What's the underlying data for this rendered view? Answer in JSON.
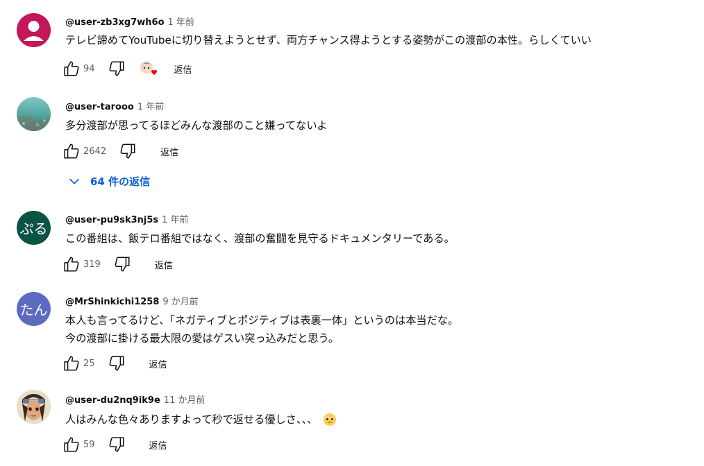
{
  "reply_label": "返信",
  "comments": [
    {
      "user": "@user-zb3xg7wh6o",
      "time": "1 年前",
      "text": [
        "テレビ諦めてYouTubeに切り替えようとせず、両方チャンス得ようとする姿勢がこの渡部の本性。らしくていい"
      ],
      "likes": "94",
      "avatar_color": "#c2185b",
      "hearted": true
    },
    {
      "user": "@user-tarooo",
      "time": "1 年前",
      "text": [
        "多分渡部が思ってるほどみんな渡部のこと嫌ってないよ"
      ],
      "likes": "2642",
      "avatar_color": "#5aa6a0",
      "replies": "64 件の返信"
    },
    {
      "user": "@user-pu9sk3nj5s",
      "time": "1 年前",
      "text": [
        "この番組は、飯テロ番組ではなく、渡部の奮闘を見守るドキュメンタリーである。"
      ],
      "likes": "319",
      "avatar_color": "#0b5345",
      "avatar_text": "ぷる"
    },
    {
      "user": "@MrShinkichi1258",
      "time": "9 か月前",
      "text": [
        "本人も言ってるけど、「ネガティブとポジティブは表裏一体」というのは本当だな。",
        "今の渡部に掛ける最大限の愛はゲスい突っ込みだと思う。"
      ],
      "likes": "25",
      "avatar_color": "#5c6bc0",
      "avatar_text": "たん"
    },
    {
      "user": "@user-du2nq9ik9e",
      "time": "11 か月前",
      "text": [
        "人はみんな色々ありますよって秒で返せる優しさ、、、"
      ],
      "likes": "59",
      "avatar_color": "#6d4c41",
      "emoji": "pleading-face"
    }
  ]
}
